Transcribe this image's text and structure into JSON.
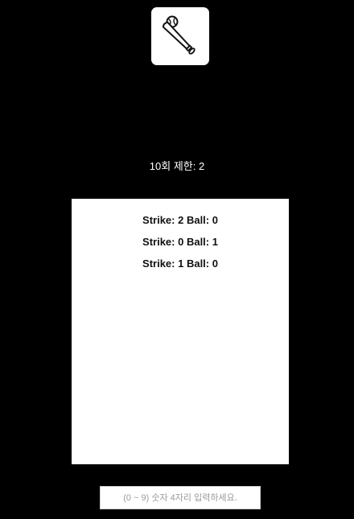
{
  "header": {
    "logo_icon": "baseball-bat-and-ball-icon"
  },
  "status": {
    "limit_text": "10회 제한: 2"
  },
  "results": {
    "items": [
      "Strike: 2 Ball: 0",
      "Strike: 0 Ball: 1",
      "Strike: 1 Ball: 0"
    ]
  },
  "guess": {
    "value": "",
    "placeholder": "(0 ~ 9) 숫자 4자리 입력하세요."
  },
  "colors": {
    "background": "#000000",
    "panel": "#ffffff",
    "text_light": "#ffffff",
    "text_dark": "#111111"
  }
}
